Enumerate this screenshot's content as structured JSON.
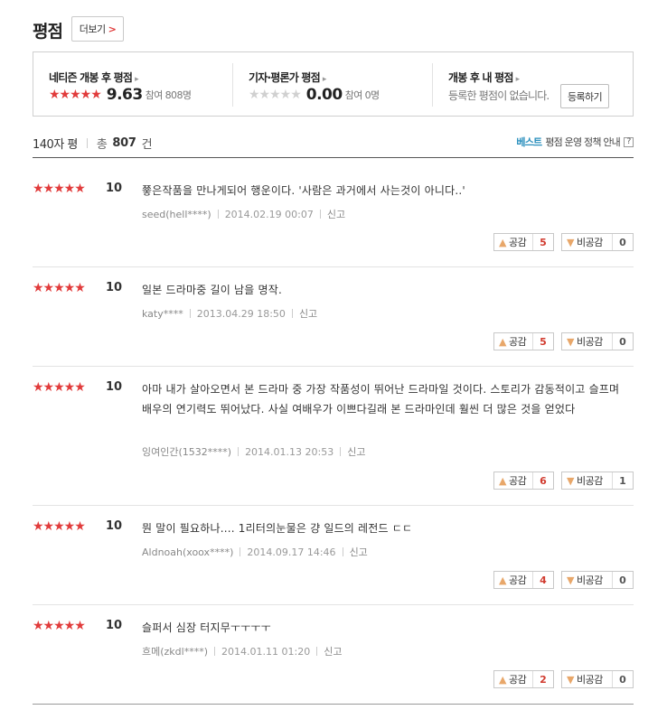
{
  "header": {
    "title": "평점",
    "more_label": "더보기",
    "more_arrow": ">"
  },
  "summary": {
    "netizen": {
      "label": "네티즌 개봉 후 평점",
      "caret": "▸",
      "stars": "★★★★★",
      "score": "9.63",
      "participants": "참여 808명"
    },
    "critic": {
      "label": "기자·평론가 평점",
      "caret": "▸",
      "stars": "★★★★★",
      "score": "0.00",
      "participants": "참여 0명"
    },
    "mine": {
      "label": "개봉 후 내 평점",
      "caret": "▸",
      "empty_text": "등록한 평점이 없습니다.",
      "register_label": "등록하기"
    }
  },
  "countbar": {
    "limit_label": "140자 평",
    "total_prefix": "총",
    "total_count": "807",
    "total_suffix": "건",
    "policy_best": "베스트",
    "policy_rest": "평점 운영 정책 안내",
    "help": "?"
  },
  "like_label": "공감",
  "dislike_label": "비공감",
  "reviews": [
    {
      "stars": "★★★★★",
      "score": "10",
      "text": "쭇은작품을 만나게되어 행운이다. '사람은 과거에서 사는것이 아니다..'",
      "author": "seed(hell****)",
      "date": "2014.02.19 00:07",
      "report": "신고",
      "likes": "5",
      "dislikes": "0"
    },
    {
      "stars": "★★★★★",
      "score": "10",
      "text": "일본 드라마중 길이 남을 명작.",
      "author": "katy****",
      "date": "2013.04.29 18:50",
      "report": "신고",
      "likes": "5",
      "dislikes": "0"
    },
    {
      "stars": "★★★★★",
      "score": "10",
      "text": "아마 내가 살아오면서 본 드라마 중 가장 작품성이 뛰어난 드라마일 것이다. 스토리가 감동적이고 슬프며 배우의 연기력도 뛰어났다. 사실 여배우가 이쁘다길래 본 드라마인데 훨씬 더 많은 것을 얻었다",
      "author": "잉여인간(1532****)",
      "date": "2014.01.13 20:53",
      "report": "신고",
      "likes": "6",
      "dislikes": "1"
    },
    {
      "stars": "★★★★★",
      "score": "10",
      "text": "뭔 말이 필요하나.... 1리터의눈물은 걍 일드의 레전드 ㄷㄷ",
      "author": "Aldnoah(xoox****)",
      "date": "2014.09.17 14:46",
      "report": "신고",
      "likes": "4",
      "dislikes": "0"
    },
    {
      "stars": "★★★★★",
      "score": "10",
      "text": "슬퍼서 심장 터지무ㅜㅜㅜㅜ",
      "author": "흐메(zkdl****)",
      "date": "2014.01.11 01:20",
      "report": "신고",
      "likes": "2",
      "dislikes": "0"
    }
  ]
}
